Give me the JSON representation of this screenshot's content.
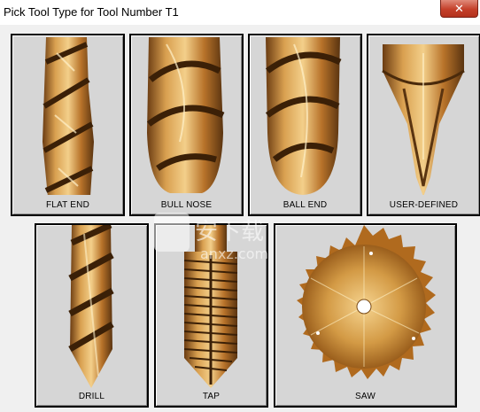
{
  "window": {
    "title": "Pick Tool Type for Tool Number T1",
    "close_glyph": "✕"
  },
  "tools": [
    {
      "label": "FLAT END",
      "icon": "flat-end-mill-icon"
    },
    {
      "label": "BULL NOSE",
      "icon": "bull-nose-mill-icon"
    },
    {
      "label": "BALL END",
      "icon": "ball-end-mill-icon"
    },
    {
      "label": "USER-DEFINED",
      "icon": "user-defined-tool-icon"
    },
    {
      "label": "DRILL",
      "icon": "drill-bit-icon"
    },
    {
      "label": "TAP",
      "icon": "tap-icon"
    },
    {
      "label": "SAW",
      "icon": "saw-blade-icon"
    }
  ],
  "watermark": {
    "text": "安下载",
    "subtext": "anxz.com"
  },
  "colors": {
    "button_face": "#d6d6d6",
    "tool_gold": "#c98a3a",
    "tool_dark": "#5a3410",
    "close_red": "#c4402a"
  }
}
